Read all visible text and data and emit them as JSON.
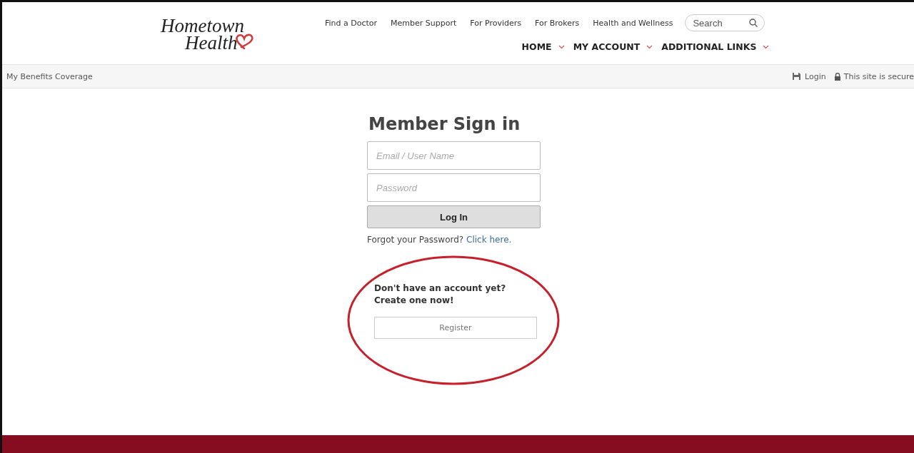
{
  "logo": {
    "line_1": "Hometown",
    "line_2": "Health"
  },
  "top_links": [
    "Find a Doctor",
    "Member Support",
    "For Providers",
    "For Brokers",
    "Health and Wellness"
  ],
  "search": {
    "placeholder": "Search"
  },
  "main_nav": [
    {
      "label": "HOME",
      "has_menu": true
    },
    {
      "label": "MY ACCOUNT",
      "has_menu": true
    },
    {
      "label": "ADDITIONAL LINKS",
      "has_menu": true
    }
  ],
  "breadcrumb": "My Benefits Coverage",
  "utility": {
    "login": "Login",
    "secure": "This site is secure"
  },
  "sign_in": {
    "title": "Member Sign in",
    "fields": [
      {
        "placeholder": "Email / User Name"
      },
      {
        "placeholder": "Password"
      }
    ],
    "button": "Log In",
    "forgot_text": "Forgot your Password?",
    "forgot_link": "Click here."
  },
  "register": {
    "prompt_1": "Don't have an account yet?",
    "prompt_2": "Create one now!",
    "button": "Register",
    "circled": true
  }
}
